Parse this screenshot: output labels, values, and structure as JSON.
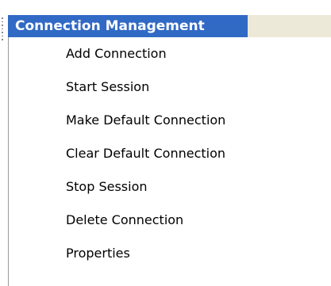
{
  "menu": {
    "title": "Connection Management",
    "items": [
      {
        "label": "Add Connection"
      },
      {
        "label": "Start Session"
      },
      {
        "label": "Make Default Connection"
      },
      {
        "label": "Clear Default Connection"
      },
      {
        "label": "Stop Session"
      },
      {
        "label": "Delete Connection"
      },
      {
        "label": "Properties"
      }
    ]
  },
  "colors": {
    "header_background": "#316ac5",
    "header_text": "#ffffff",
    "toolbar_background": "#ece9d8",
    "menu_text": "#000000"
  }
}
